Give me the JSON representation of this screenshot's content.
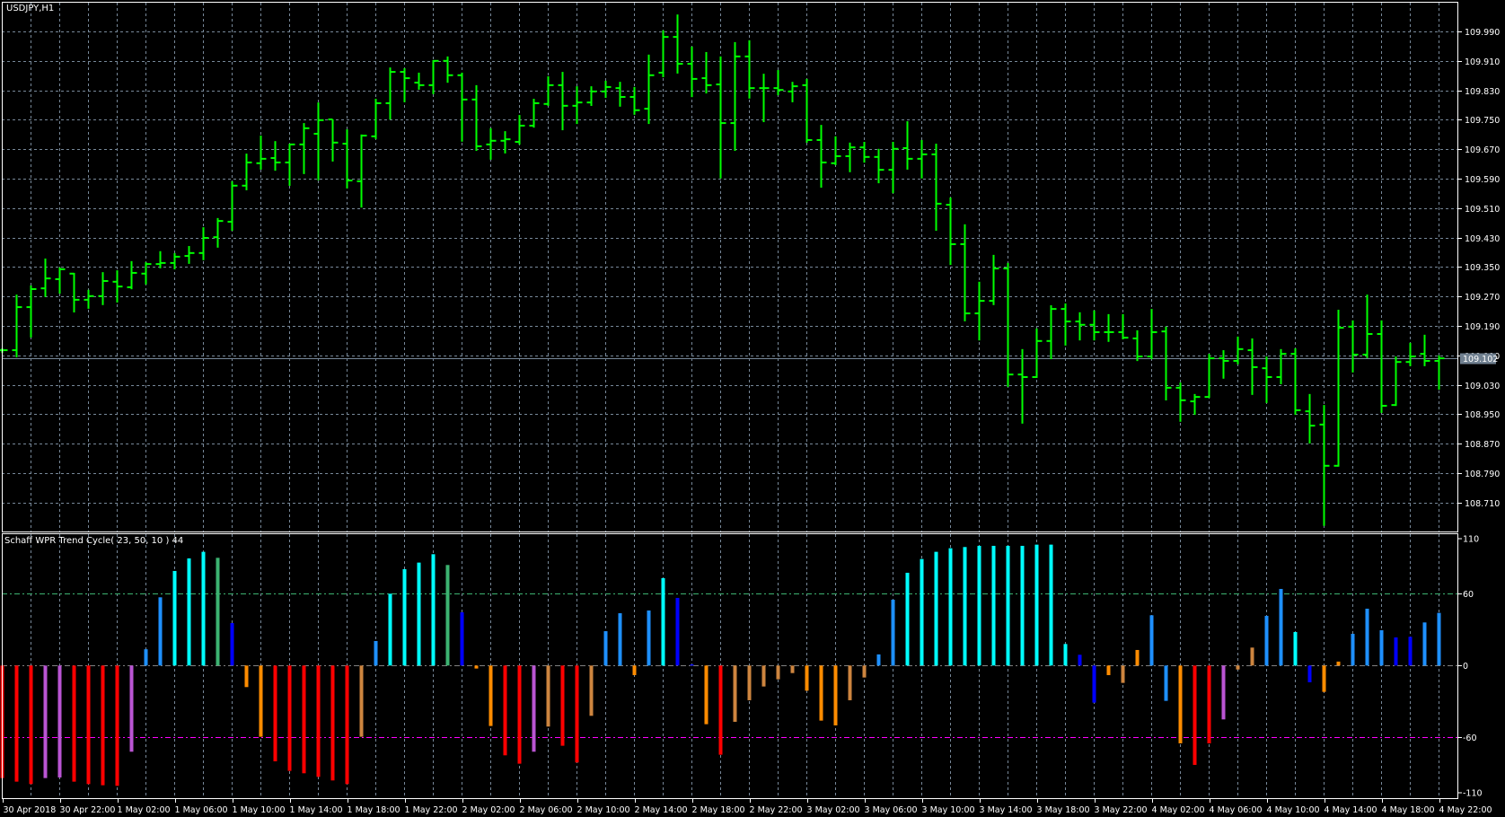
{
  "symbol_title": "USDJPY,H1",
  "indicator_title": "Schaff WPR Trend Cycle( 23, 50, 10 ) 44",
  "colors": {
    "background": "#000000",
    "bars": "#00ff00",
    "grid": "#778899",
    "axis": "#ffffff",
    "level_upper": "#3cb371",
    "level_zero": "#808080",
    "level_lower": "#ff00ff",
    "price_line": "#778899",
    "price_label_bg": "#708090",
    "C": "#00ffff",
    "G": "#3cb371",
    "D": "#1e90ff",
    "B": "#0000ff",
    "R": "#ff0000",
    "V": "#ba55d3",
    "O": "#ff8c00",
    "P": "#cd853f"
  },
  "price_axis": {
    "labels": [
      "109.990",
      "109.910",
      "109.830",
      "109.750",
      "109.670",
      "109.590",
      "109.510",
      "109.430",
      "109.350",
      "109.270",
      "109.190",
      "109.110",
      "109.030",
      "108.950",
      "108.870",
      "108.790",
      "108.710"
    ],
    "current_price": "109.102"
  },
  "indicator_axis": {
    "labels": [
      "110",
      "60",
      "0",
      "-60",
      "-110"
    ],
    "levels": [
      60,
      0,
      -60
    ]
  },
  "time_axis": [
    "30 Apr 2018",
    "30 Apr 22:00",
    "1 May 02:00",
    "1 May 06:00",
    "1 May 10:00",
    "1 May 14:00",
    "1 May 18:00",
    "1 May 22:00",
    "2 May 02:00",
    "2 May 06:00",
    "2 May 10:00",
    "2 May 14:00",
    "2 May 18:00",
    "2 May 22:00",
    "3 May 02:00",
    "3 May 06:00",
    "3 May 10:00",
    "3 May 14:00",
    "3 May 18:00",
    "3 May 22:00",
    "4 May 02:00",
    "4 May 06:00",
    "4 May 10:00",
    "4 May 14:00",
    "4 May 18:00",
    "4 May 22:00"
  ],
  "ohlc": [
    [
      109.124,
      109.129,
      109.119,
      109.124
    ],
    [
      109.124,
      109.275,
      109.107,
      109.241
    ],
    [
      109.241,
      109.3,
      109.161,
      109.29
    ],
    [
      109.292,
      109.373,
      109.271,
      109.319
    ],
    [
      109.317,
      109.349,
      109.28,
      109.344
    ],
    [
      109.332,
      109.334,
      109.229,
      109.261
    ],
    [
      109.261,
      109.288,
      109.239,
      109.271
    ],
    [
      109.271,
      109.336,
      109.249,
      109.312
    ],
    [
      109.31,
      109.341,
      109.256,
      109.297
    ],
    [
      109.295,
      109.366,
      109.292,
      109.334
    ],
    [
      109.332,
      109.363,
      109.305,
      109.358
    ],
    [
      109.358,
      109.393,
      109.349,
      109.361
    ],
    [
      109.361,
      109.388,
      109.346,
      109.378
    ],
    [
      109.38,
      109.407,
      109.361,
      109.388
    ],
    [
      109.388,
      109.458,
      109.371,
      109.429
    ],
    [
      109.431,
      109.483,
      109.405,
      109.475
    ],
    [
      109.473,
      109.583,
      109.451,
      109.571
    ],
    [
      109.571,
      109.658,
      109.561,
      109.634
    ],
    [
      109.632,
      109.707,
      109.617,
      109.644
    ],
    [
      109.646,
      109.692,
      109.614,
      109.634
    ],
    [
      109.634,
      109.685,
      109.573,
      109.683
    ],
    [
      109.683,
      109.741,
      109.605,
      109.727
    ],
    [
      109.712,
      109.797,
      109.588,
      109.749
    ],
    [
      109.751,
      109.751,
      109.639,
      109.688
    ],
    [
      109.685,
      109.724,
      109.566,
      109.585
    ],
    [
      109.583,
      109.71,
      109.514,
      109.707
    ],
    [
      109.705,
      109.807,
      109.7,
      109.795
    ],
    [
      109.795,
      109.892,
      109.753,
      109.88
    ],
    [
      109.88,
      109.89,
      109.8,
      109.863
    ],
    [
      109.851,
      109.878,
      109.834,
      109.844
    ],
    [
      109.844,
      109.912,
      109.822,
      109.91
    ],
    [
      109.91,
      109.922,
      109.853,
      109.871
    ],
    [
      109.871,
      109.878,
      109.693,
      109.805
    ],
    [
      109.805,
      109.844,
      109.668,
      109.678
    ],
    [
      109.683,
      109.727,
      109.644,
      109.693
    ],
    [
      109.693,
      109.719,
      109.661,
      109.697
    ],
    [
      109.69,
      109.763,
      109.685,
      109.734
    ],
    [
      109.734,
      109.807,
      109.731,
      109.795
    ],
    [
      109.793,
      109.868,
      109.79,
      109.844
    ],
    [
      109.844,
      109.88,
      109.724,
      109.788
    ],
    [
      109.788,
      109.841,
      109.741,
      109.797
    ],
    [
      109.797,
      109.841,
      109.79,
      109.827
    ],
    [
      109.827,
      109.856,
      109.812,
      109.839
    ],
    [
      109.836,
      109.853,
      109.788,
      109.812
    ],
    [
      109.812,
      109.839,
      109.766,
      109.776
    ],
    [
      109.78,
      109.927,
      109.741,
      109.871
    ],
    [
      109.878,
      109.993,
      109.868,
      109.975
    ],
    [
      109.975,
      110.036,
      109.878,
      109.902
    ],
    [
      109.902,
      109.949,
      109.814,
      109.861
    ],
    [
      109.863,
      109.934,
      109.824,
      109.844
    ],
    [
      109.846,
      109.922,
      109.593,
      109.741
    ],
    [
      109.741,
      109.961,
      109.668,
      109.922
    ],
    [
      109.922,
      109.966,
      109.81,
      109.836
    ],
    [
      109.836,
      109.875,
      109.746,
      109.836
    ],
    [
      109.836,
      109.885,
      109.819,
      109.831
    ],
    [
      109.827,
      109.853,
      109.8,
      109.841
    ],
    [
      109.844,
      109.861,
      109.69,
      109.695
    ],
    [
      109.695,
      109.736,
      109.568,
      109.634
    ],
    [
      109.632,
      109.705,
      109.629,
      109.651
    ],
    [
      109.651,
      109.688,
      109.61,
      109.675
    ],
    [
      109.675,
      109.69,
      109.636,
      109.649
    ],
    [
      109.649,
      109.671,
      109.58,
      109.614
    ],
    [
      109.614,
      109.69,
      109.553,
      109.671
    ],
    [
      109.673,
      109.746,
      109.617,
      109.644
    ],
    [
      109.644,
      109.695,
      109.593,
      109.656
    ],
    [
      109.656,
      109.685,
      109.451,
      109.522
    ],
    [
      109.519,
      109.539,
      109.358,
      109.412
    ],
    [
      109.412,
      109.466,
      109.205,
      109.224
    ],
    [
      109.224,
      109.31,
      109.153,
      109.258
    ],
    [
      109.258,
      109.383,
      109.249,
      109.346
    ],
    [
      109.346,
      109.361,
      109.027,
      109.058
    ],
    [
      109.058,
      109.127,
      108.927,
      109.051
    ],
    [
      109.051,
      109.183,
      109.051,
      109.149
    ],
    [
      109.149,
      109.246,
      109.102,
      109.236
    ],
    [
      109.236,
      109.251,
      109.139,
      109.202
    ],
    [
      109.202,
      109.227,
      109.153,
      109.193
    ],
    [
      109.193,
      109.232,
      109.153,
      109.173
    ],
    [
      109.173,
      109.222,
      109.149,
      109.173
    ],
    [
      109.173,
      109.222,
      109.156,
      109.158
    ],
    [
      109.156,
      109.178,
      109.097,
      109.107
    ],
    [
      109.107,
      109.236,
      109.102,
      109.173
    ],
    [
      109.175,
      109.188,
      108.99,
      109.022
    ],
    [
      109.022,
      109.036,
      108.932,
      108.988
    ],
    [
      108.985,
      109.005,
      108.951,
      108.997
    ],
    [
      108.997,
      109.114,
      108.997,
      109.102
    ],
    [
      109.102,
      109.124,
      109.049,
      109.095
    ],
    [
      109.095,
      109.161,
      109.088,
      109.127
    ],
    [
      109.124,
      109.156,
      109.005,
      109.078
    ],
    [
      109.075,
      109.107,
      108.983,
      109.051
    ],
    [
      109.051,
      109.127,
      109.034,
      109.114
    ],
    [
      109.114,
      109.129,
      108.951,
      108.961
    ],
    [
      108.958,
      109.005,
      108.873,
      108.919
    ],
    [
      108.922,
      108.975,
      108.649,
      108.81
    ],
    [
      108.81,
      109.234,
      108.81,
      109.185
    ],
    [
      109.188,
      109.205,
      109.066,
      109.112
    ],
    [
      109.112,
      109.275,
      109.105,
      109.168
    ],
    [
      109.168,
      109.205,
      108.956,
      108.973
    ],
    [
      108.975,
      109.107,
      108.975,
      109.092
    ],
    [
      109.092,
      109.144,
      109.083,
      109.107
    ],
    [
      109.114,
      109.166,
      109.083,
      109.095
    ],
    [
      109.095,
      109.11,
      109.019,
      109.102
    ]
  ],
  "indicator_values": [
    -94,
    -97,
    -99,
    -94,
    -93.5,
    -97,
    -99,
    -100,
    -100.5,
    -72,
    13.6,
    57,
    79,
    89.5,
    95,
    90,
    35.5,
    -18,
    -59.5,
    -80,
    -88,
    -90,
    -93,
    -96,
    -99,
    -59.5,
    20.5,
    60,
    80.5,
    86,
    93,
    84,
    44.5,
    -2.5,
    -50.5,
    -75,
    -82,
    -72,
    -51,
    -67,
    -81,
    -42,
    28.7,
    43.7,
    -8,
    46,
    73,
    56.5,
    1,
    -49,
    -74.5,
    -47,
    -29,
    -17.5,
    -11.5,
    -6.3,
    -21,
    -46,
    -50,
    -29,
    -10,
    9.3,
    55,
    77.5,
    89,
    95,
    98,
    99,
    100,
    100,
    100,
    100,
    101,
    101,
    18,
    9,
    -31,
    -8,
    -14.5,
    13,
    42,
    -29.5,
    -65,
    -83,
    -65,
    -45,
    -3.3,
    15,
    41.5,
    64,
    28,
    -14,
    -22,
    3.3,
    26.5,
    47.5,
    29.5,
    23.5,
    24,
    36,
    44
  ],
  "indicator_colors": "RRRVVRRRRVDDCCCGBOORRRRRRPDCCCCGBOORRVPRRPDDODCBBORPPPPPOOOPPDDCCCCCCCCCCCCBBOPODDORRVPPDDCBOODDDBBDDD"
}
